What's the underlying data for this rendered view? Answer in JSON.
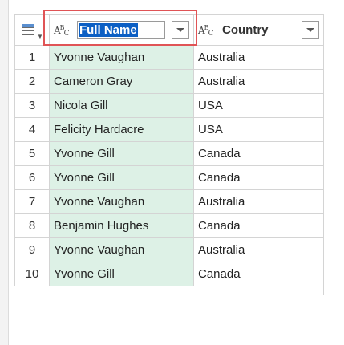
{
  "header": {
    "name_column": {
      "type_icon": "ABC",
      "editing_value": "Full Name"
    },
    "country_column": {
      "type_icon": "ABC",
      "label": "Country"
    }
  },
  "rows": [
    {
      "index": "1",
      "name": "Yvonne Vaughan",
      "country": "Australia"
    },
    {
      "index": "2",
      "name": "Cameron Gray",
      "country": "Australia"
    },
    {
      "index": "3",
      "name": "Nicola Gill",
      "country": "USA"
    },
    {
      "index": "4",
      "name": "Felicity Hardacre",
      "country": "USA"
    },
    {
      "index": "5",
      "name": "Yvonne Gill",
      "country": "Canada"
    },
    {
      "index": "6",
      "name": "Yvonne Gill",
      "country": "Canada"
    },
    {
      "index": "7",
      "name": "Yvonne Vaughan",
      "country": "Australia"
    },
    {
      "index": "8",
      "name": "Benjamin Hughes",
      "country": "Canada"
    },
    {
      "index": "9",
      "name": "Yvonne Vaughan",
      "country": "Australia"
    },
    {
      "index": "10",
      "name": "Yvonne Gill",
      "country": "Canada"
    }
  ],
  "colors": {
    "selected_column_bg": "#ddf1e6",
    "selection_highlight": "#0c5fc4",
    "annotation_box": "#e05456"
  },
  "icons": [
    "table-menu-icon",
    "text-type-icon",
    "dropdown-arrow-icon"
  ]
}
